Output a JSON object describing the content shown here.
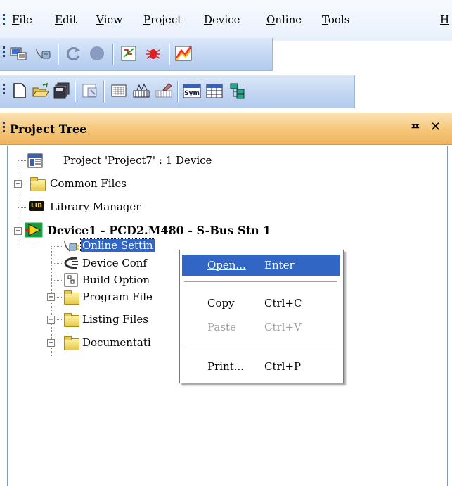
{
  "menu": {
    "items": [
      {
        "label": "File"
      },
      {
        "label": "Edit"
      },
      {
        "label": "View"
      },
      {
        "label": "Project"
      },
      {
        "label": "Device"
      },
      {
        "label": "Online"
      },
      {
        "label": "Tools"
      },
      {
        "label": "H"
      }
    ]
  },
  "toolbar1": {
    "buttons": [
      "project-manager-icon",
      "online-settings-icon",
      "refresh-icon",
      "stop-icon",
      "build-icon",
      "debug-icon",
      "download-icon"
    ]
  },
  "toolbar2": {
    "buttons": [
      "new-file-icon",
      "open-folder-icon",
      "save-all-icon",
      "properties-icon",
      "grid-icon",
      "chart-icon",
      "eraser-icon",
      "symbols-icon",
      "table-icon",
      "hierarchy-icon"
    ],
    "sym_label": "Sym"
  },
  "project_tree": {
    "title": "Project Tree",
    "pin_glyph": "ᄑ",
    "close_glyph": "✕",
    "items": [
      {
        "label": "Project 'Project7' : 1 Device"
      },
      {
        "label": "Common Files"
      },
      {
        "label": "Library Manager",
        "badge": "LIB"
      },
      {
        "label": "Device1 - PCD2.M480 - S-Bus Stn 1"
      },
      {
        "label": "Online Settin"
      },
      {
        "label": "Device Conf"
      },
      {
        "label": "Build Option"
      },
      {
        "label": "Program File"
      },
      {
        "label": "Listing Files"
      },
      {
        "label": "Documentati"
      }
    ]
  },
  "context_menu": {
    "items": [
      {
        "label": "Open...",
        "shortcut": "Enter",
        "underline": "O"
      },
      {
        "label": "Copy",
        "shortcut": "Ctrl+C",
        "underline": "C"
      },
      {
        "label": "Paste",
        "shortcut": "Ctrl+V",
        "underline": "s"
      },
      {
        "label": "Print...",
        "shortcut": "Ctrl+P",
        "underline": "P"
      }
    ]
  }
}
